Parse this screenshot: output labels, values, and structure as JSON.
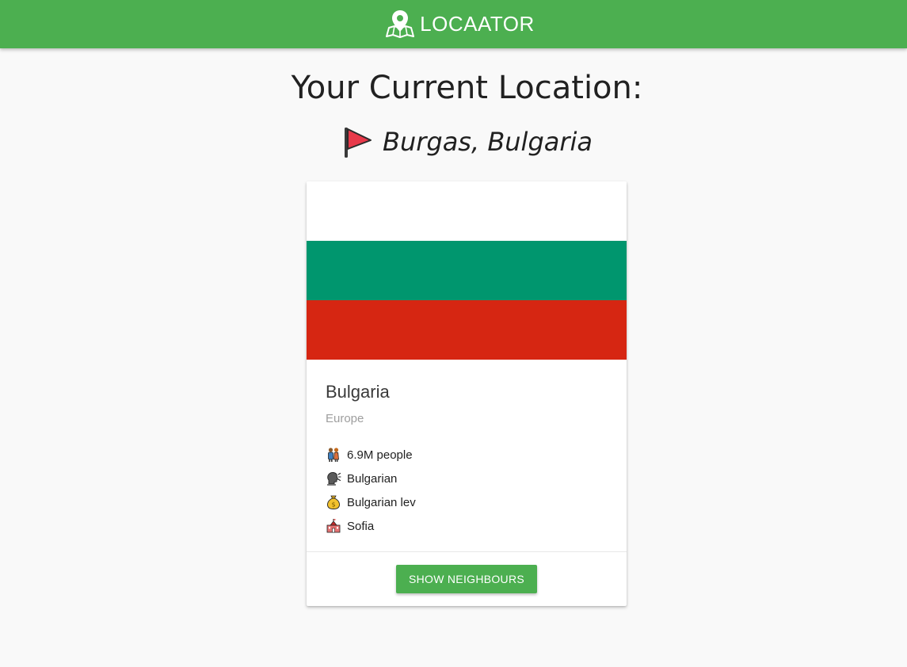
{
  "app": {
    "brand": "LOCAATOR",
    "brand_icon": "map-pin-icon",
    "accent_color": "#4caf50"
  },
  "main": {
    "heading": "Your Current Location:",
    "location_icon": "red-flag-icon",
    "location": "Burgas, Bulgaria"
  },
  "card": {
    "flag_colors": [
      "#ffffff",
      "#00966e",
      "#d62612"
    ],
    "country": "Bulgaria",
    "region": "Europe",
    "facts": [
      {
        "icon": "people-icon",
        "text": "6.9M people"
      },
      {
        "icon": "speaking-head-icon",
        "text": "Bulgarian"
      },
      {
        "icon": "money-bag-icon",
        "text": "Bulgarian lev"
      },
      {
        "icon": "capital-building-icon",
        "text": "Sofia"
      }
    ],
    "button_label": "SHOW NEIGHBOURS"
  }
}
